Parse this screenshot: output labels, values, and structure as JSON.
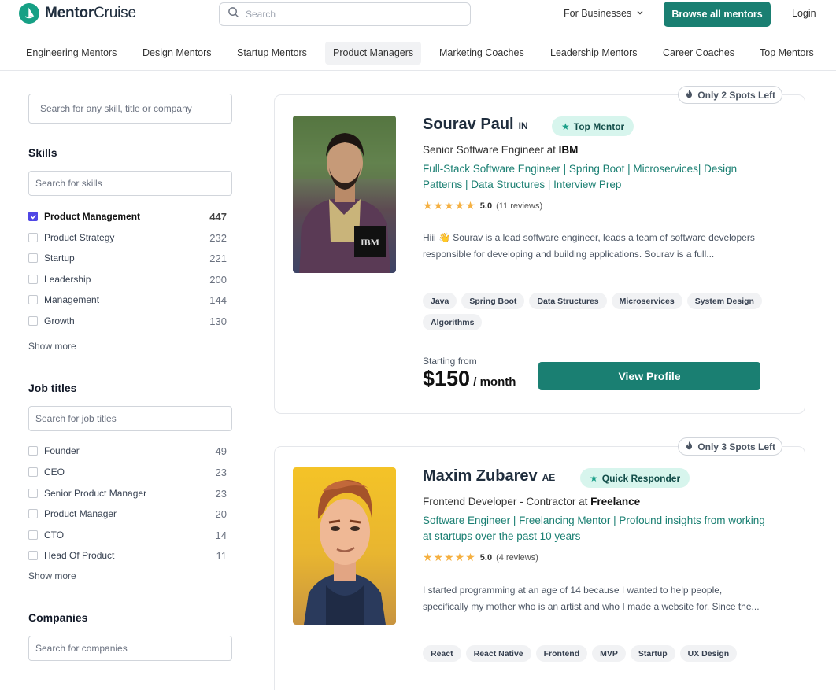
{
  "brand": {
    "name_bold": "Mentor",
    "name_light": "Cruise"
  },
  "search": {
    "placeholder": "Search"
  },
  "header": {
    "for_businesses": "For Businesses",
    "browse_button": "Browse all mentors",
    "login": "Login"
  },
  "categories": [
    "Engineering Mentors",
    "Design Mentors",
    "Startup Mentors",
    "Product Managers",
    "Marketing Coaches",
    "Leadership Mentors",
    "Career Coaches",
    "Top Mentors"
  ],
  "active_category": "Product Managers",
  "sidebar": {
    "main_search_placeholder": "Search for any skill, title or company",
    "skills": {
      "title": "Skills",
      "placeholder": "Search for skills",
      "items": [
        {
          "label": "Product Management",
          "count": "447",
          "checked": true
        },
        {
          "label": "Product Strategy",
          "count": "232",
          "checked": false
        },
        {
          "label": "Startup",
          "count": "221",
          "checked": false
        },
        {
          "label": "Leadership",
          "count": "200",
          "checked": false
        },
        {
          "label": "Management",
          "count": "144",
          "checked": false
        },
        {
          "label": "Growth",
          "count": "130",
          "checked": false
        }
      ],
      "show_more": "Show more"
    },
    "job_titles": {
      "title": "Job titles",
      "placeholder": "Search for job titles",
      "items": [
        {
          "label": "Founder",
          "count": "49",
          "checked": false
        },
        {
          "label": "CEO",
          "count": "23",
          "checked": false
        },
        {
          "label": "Senior Product Manager",
          "count": "23",
          "checked": false
        },
        {
          "label": "Product Manager",
          "count": "20",
          "checked": false
        },
        {
          "label": "CTO",
          "count": "14",
          "checked": false
        },
        {
          "label": "Head Of Product",
          "count": "11",
          "checked": false
        }
      ],
      "show_more": "Show more"
    },
    "companies": {
      "title": "Companies",
      "placeholder": "Search for companies"
    }
  },
  "mentors": [
    {
      "spots": "Only 2 Spots Left",
      "name": "Sourav Paul",
      "country": "IN",
      "badge": "Top Mentor",
      "role_prefix": "Senior Software Engineer at",
      "company": "IBM",
      "logo_text": "IBM",
      "tagline": "Full-Stack Software Engineer | Spring Boot | Microservices| Design Patterns | Data Structures | Interview Prep",
      "stars": "★★★★★",
      "rating": "5.0",
      "reviews": "(11 reviews)",
      "bio": "Hiii 👋 Sourav is a lead software engineer, leads a team of software developers responsible for developing and building applications. Sourav is a full...",
      "skills": [
        "Java",
        "Spring Boot",
        "Data Structures",
        "Microservices",
        "System Design",
        "Algorithms"
      ],
      "starting_from": "Starting from",
      "price": "$150",
      "per": " / month",
      "cta": "View Profile"
    },
    {
      "spots": "Only 3 Spots Left",
      "name": "Maxim Zubarev",
      "country": "AE",
      "badge": "Quick Responder",
      "role_prefix": "Frontend Developer - Contractor at",
      "company": "Freelance",
      "tagline": "Software Engineer | Freelancing Mentor | Profound insights from working at startups over the past 10 years",
      "stars": "★★★★★",
      "rating": "5.0",
      "reviews": "(4 reviews)",
      "bio": "I started programming at an age of 14 because I wanted to help people, specifically my mother who is an artist and who I made a website for. Since the...",
      "skills": [
        "React",
        "React Native",
        "Frontend",
        "MVP",
        "Startup",
        "UX Design"
      ]
    }
  ],
  "colors": {
    "brand": "#1a7f72",
    "logo": "#16a085",
    "checkbox": "#4f46e5",
    "badge_bg": "#d7f5ed",
    "star": "#f5b041"
  }
}
